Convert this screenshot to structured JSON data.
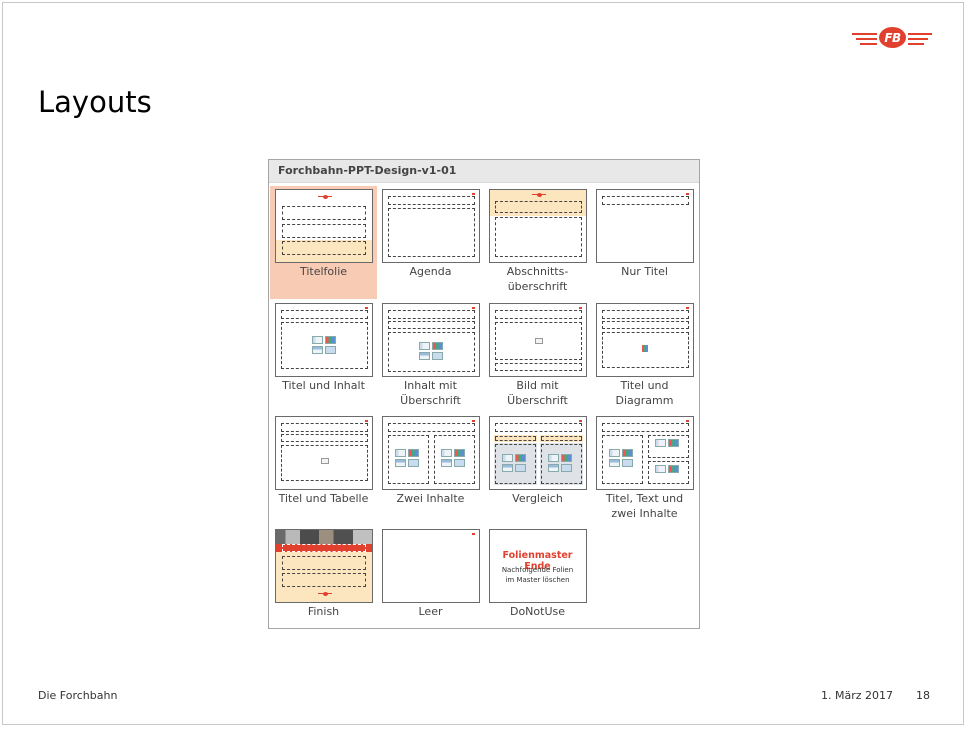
{
  "slide": {
    "title": "Layouts",
    "logo_text": "FB",
    "footer": {
      "left": "Die Forchbahn",
      "date": "1. März 2017",
      "page": "18"
    }
  },
  "gallery": {
    "header": "Forchbahn-PPT-Design-v1-01",
    "selected": "Titelfolie",
    "layouts": [
      {
        "label": "Titelfolie"
      },
      {
        "label": "Agenda"
      },
      {
        "label": "Abschnitts-\nüberschrift"
      },
      {
        "label": "Nur Titel"
      },
      {
        "label": "Titel und Inhalt"
      },
      {
        "label": "Inhalt mit\nÜberschrift"
      },
      {
        "label": "Bild mit\nÜberschrift"
      },
      {
        "label": "Titel und\nDiagramm"
      },
      {
        "label": "Titel und Tabelle"
      },
      {
        "label": "Zwei Inhalte"
      },
      {
        "label": "Vergleich"
      },
      {
        "label": "Titel, Text und\nzwei Inhalte"
      },
      {
        "label": "Finish"
      },
      {
        "label": "Leer"
      },
      {
        "label": "DoNotUse",
        "thumb_title": "Folienmaster Ende",
        "thumb_text": "Nachfolgende Folien\nim Master löschen"
      }
    ]
  },
  "colors": {
    "accent": "#e2402f",
    "selection": "#f8cbb5",
    "band": "#fbe6c0"
  }
}
